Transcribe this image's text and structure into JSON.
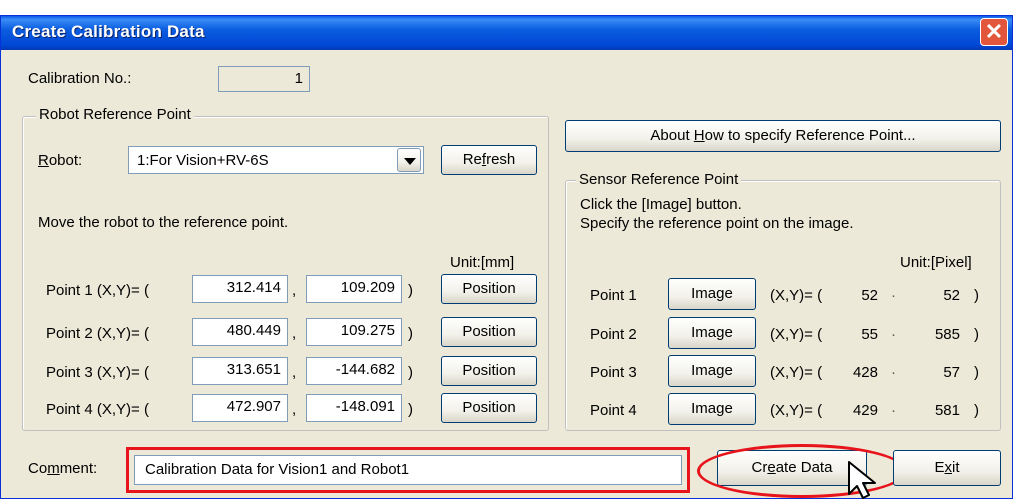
{
  "window": {
    "title": "Create Calibration Data",
    "close": "✕"
  },
  "calibration": {
    "label": "Calibration No.:",
    "value": "1"
  },
  "robot_group": {
    "legend": "Robot Reference Point",
    "robot_label": "Robot:",
    "robot_value": "1:For Vision+RV-6S",
    "refresh_label": "Refresh",
    "instruction": "Move the robot to the reference point.",
    "unit": "Unit:[mm]",
    "points": [
      {
        "label": "Point 1 (X,Y)= (",
        "x": "312.414",
        "y": "109.209",
        "btn": "Position"
      },
      {
        "label": "Point 2 (X,Y)= (",
        "x": "480.449",
        "y": "109.275",
        "btn": "Position"
      },
      {
        "label": "Point 3 (X,Y)= (",
        "x": "313.651",
        "y": "-144.682",
        "btn": "Position"
      },
      {
        "label": "Point 4 (X,Y)= (",
        "x": "472.907",
        "y": "-148.091",
        "btn": "Position"
      }
    ],
    "comma": ",",
    "close_paren": ")"
  },
  "about_button": "About How to specify Reference Point...",
  "sensor_group": {
    "legend": "Sensor Reference Point",
    "line1": "Click the [Image] button.",
    "line2": "Specify the reference point on the image.",
    "unit": "Unit:[Pixel]",
    "xy_prefix": "(X,Y)= (",
    "close_paren": ")",
    "dot": "·",
    "points": [
      {
        "label": "Point 1",
        "btn": "Image",
        "x": "52",
        "y": "52"
      },
      {
        "label": "Point 2",
        "btn": "Image",
        "x": "55",
        "y": "585"
      },
      {
        "label": "Point 3",
        "btn": "Image",
        "x": "428",
        "y": "57"
      },
      {
        "label": "Point 4",
        "btn": "Image",
        "x": "429",
        "y": "581"
      }
    ]
  },
  "comment": {
    "label": "Comment:",
    "value": "Calibration Data for Vision1 and Robot1"
  },
  "buttons": {
    "create": "Create Data",
    "exit": "Exit"
  },
  "colors": {
    "highlight": "#e8141b",
    "title_bar": "#0054e3"
  }
}
